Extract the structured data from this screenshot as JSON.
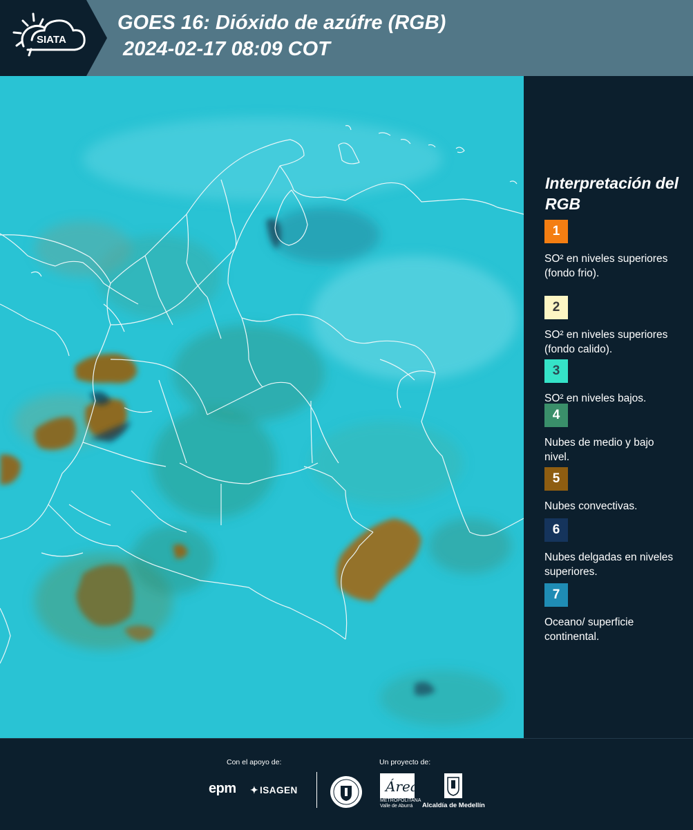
{
  "header": {
    "logo_text": "SIATA",
    "title_line1": "GOES 16: Dióxido de azúfre (RGB)",
    "title_line2": " 2024-02-17 08:09 COT"
  },
  "legend": {
    "title": "Interpretación del RGB",
    "items": [
      {
        "number": "1",
        "label": "SO² en niveles superiores (fondo frio).",
        "color": "#f47e12",
        "text_color": "#ffffff"
      },
      {
        "number": "2",
        "label": "SO² en niveles superiores (fondo calido).",
        "color": "#fdf6c4",
        "text_color": "#3a3a3a"
      },
      {
        "number": "3",
        "label": "SO² en niveles bajos.",
        "color": "#35e3c8",
        "text_color": "#2b4a54"
      },
      {
        "number": "4",
        "label": "Nubes de medio y bajo nivel.",
        "color": "#3a8f6a",
        "text_color": "#ffffff"
      },
      {
        "number": "5",
        "label": "Nubes convectivas.",
        "color": "#8e5d11",
        "text_color": "#ffffff"
      },
      {
        "number": "6",
        "label": "Nubes delgadas en niveles superiores.",
        "color": "#15345c",
        "text_color": "#ffffff"
      },
      {
        "number": "7",
        "label": "Oceano/ superficie continental.",
        "color": "#1f8cb4",
        "text_color": "#ffffff"
      }
    ]
  },
  "footer": {
    "support_label": "Con el apoyo de:",
    "project_label": "Un proyecto de:",
    "epm": "epm",
    "isagen": "ISAGEN",
    "area_text": "METROPOLITANA Valle de Aburrá",
    "alcaldia": "Alcaldía de Medellín"
  },
  "colors": {
    "header_bg": "#527787",
    "panel_bg": "#0c1f2d",
    "ocean": "#27c6d6",
    "convective": "#8a6a1e"
  }
}
